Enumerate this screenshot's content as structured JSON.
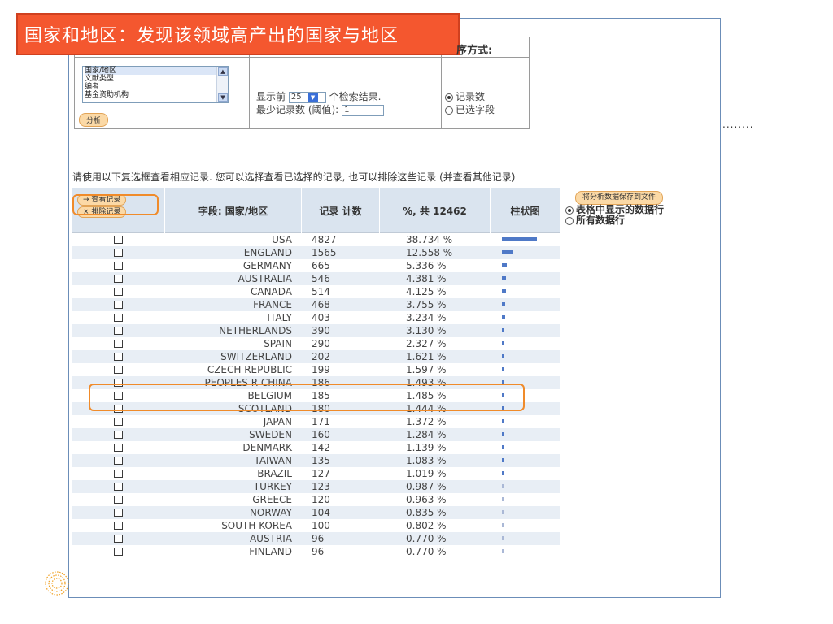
{
  "slide": {
    "title": "国家和地区：发现该领域高产出的国家与地区",
    "ellipsis": "........"
  },
  "controls": {
    "sort_title": "序方式:",
    "field_list": [
      "国家/地区",
      "文献类型",
      "编者",
      "基金资助机构"
    ],
    "show_top_prefix": "显示前",
    "show_top_value": "25",
    "show_top_suffix": "个检索结果.",
    "min_records_label": "最少记录数 (阈值):",
    "min_records_value": "1",
    "sort_option_records": "记录数",
    "sort_option_field": "已选字段",
    "analyze_button": "分析"
  },
  "instruction": "请使用以下复选框查看相应记录. 您可以选择查看已选择的记录, 也可以排除这些记录 (并查看其他记录)",
  "table": {
    "view_records": "→ 查看记录",
    "exclude_records": "× 排除记录",
    "col_field": "字段: 国家/地区",
    "col_count": "记录 计数",
    "col_pct": "%, 共 12462",
    "col_bar": "柱状图",
    "save_button": "将分析数据保存到文件",
    "save_opt_table": "表格中显示的数据行",
    "save_opt_all": "所有数据行",
    "rows": [
      {
        "country": "USA",
        "count": "4827",
        "pct": "38.734 %",
        "fraction": 0.38734
      },
      {
        "country": "ENGLAND",
        "count": "1565",
        "pct": "12.558 %",
        "fraction": 0.12558
      },
      {
        "country": "GERMANY",
        "count": "665",
        "pct": "5.336 %",
        "fraction": 0.05336
      },
      {
        "country": "AUSTRALIA",
        "count": "546",
        "pct": "4.381 %",
        "fraction": 0.04381
      },
      {
        "country": "CANADA",
        "count": "514",
        "pct": "4.125 %",
        "fraction": 0.04125
      },
      {
        "country": "FRANCE",
        "count": "468",
        "pct": "3.755 %",
        "fraction": 0.03755
      },
      {
        "country": "ITALY",
        "count": "403",
        "pct": "3.234 %",
        "fraction": 0.03234
      },
      {
        "country": "NETHERLANDS",
        "count": "390",
        "pct": "3.130 %",
        "fraction": 0.0313
      },
      {
        "country": "SPAIN",
        "count": "290",
        "pct": "2.327 %",
        "fraction": 0.02327
      },
      {
        "country": "SWITZERLAND",
        "count": "202",
        "pct": "1.621 %",
        "fraction": 0.01621
      },
      {
        "country": "CZECH REPUBLIC",
        "count": "199",
        "pct": "1.597 %",
        "fraction": 0.01597
      },
      {
        "country": "PEOPLES R CHINA",
        "count": "186",
        "pct": "1.493 %",
        "fraction": 0.01493
      },
      {
        "country": "BELGIUM",
        "count": "185",
        "pct": "1.485 %",
        "fraction": 0.01485
      },
      {
        "country": "SCOTLAND",
        "count": "180",
        "pct": "1.444 %",
        "fraction": 0.01444
      },
      {
        "country": "JAPAN",
        "count": "171",
        "pct": "1.372 %",
        "fraction": 0.01372
      },
      {
        "country": "SWEDEN",
        "count": "160",
        "pct": "1.284 %",
        "fraction": 0.01284
      },
      {
        "country": "DENMARK",
        "count": "142",
        "pct": "1.139 %",
        "fraction": 0.01139
      },
      {
        "country": "TAIWAN",
        "count": "135",
        "pct": "1.083 %",
        "fraction": 0.01083
      },
      {
        "country": "BRAZIL",
        "count": "127",
        "pct": "1.019 %",
        "fraction": 0.01019
      },
      {
        "country": "TURKEY",
        "count": "123",
        "pct": "0.987 %",
        "fraction": 0.00987
      },
      {
        "country": "GREECE",
        "count": "120",
        "pct": "0.963 %",
        "fraction": 0.00963
      },
      {
        "country": "NORWAY",
        "count": "104",
        "pct": "0.835 %",
        "fraction": 0.00835
      },
      {
        "country": "SOUTH KOREA",
        "count": "100",
        "pct": "0.802 %",
        "fraction": 0.00802
      },
      {
        "country": "AUSTRIA",
        "count": "96",
        "pct": "0.770 %",
        "fraction": 0.0077
      },
      {
        "country": "FINLAND",
        "count": "96",
        "pct": "0.770 %",
        "fraction": 0.0077
      }
    ]
  },
  "colors": {
    "title_bg": "#f4572f",
    "highlight": "#f08b2a",
    "bar": "#4f79c7",
    "header_bg": "#dae4ef"
  }
}
